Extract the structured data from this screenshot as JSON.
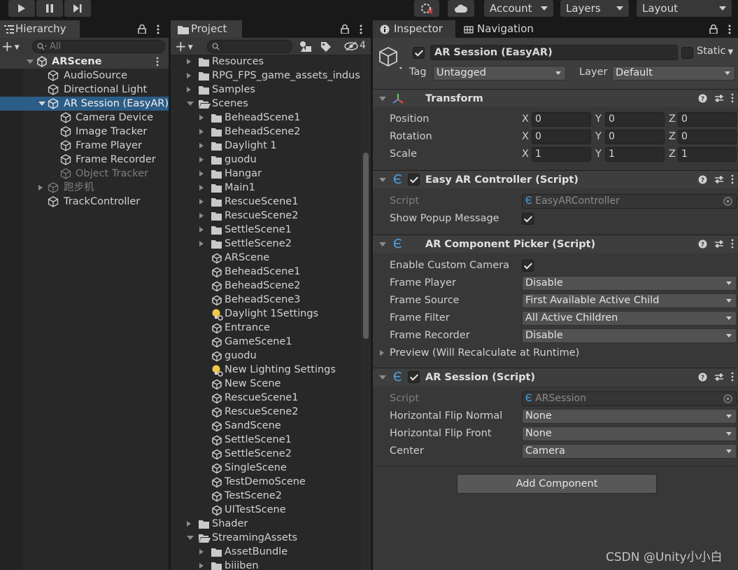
{
  "toolbar": {
    "account": "Account",
    "layers": "Layers",
    "layout": "Layout"
  },
  "hierarchy": {
    "tab": "Hierarchy",
    "search_placeholder": "All",
    "scene": "ARScene",
    "items": [
      {
        "label": "AudioSource"
      },
      {
        "label": "Directional Light"
      },
      {
        "label": "AR Session (EasyAR)"
      },
      {
        "label": "Camera Device"
      },
      {
        "label": "Image Tracker"
      },
      {
        "label": "Frame Player"
      },
      {
        "label": "Frame Recorder"
      },
      {
        "label": "Object Tracker"
      },
      {
        "label": "跑步机"
      },
      {
        "label": "TrackController"
      }
    ]
  },
  "project": {
    "tab": "Project",
    "hidden_count": "4",
    "items": [
      {
        "label": "Resources",
        "kind": "folder"
      },
      {
        "label": "RPG_FPS_game_assets_indus",
        "kind": "folder"
      },
      {
        "label": "Samples",
        "kind": "folder"
      },
      {
        "label": "Scenes",
        "kind": "folder-open"
      },
      {
        "label": "BeheadScene1",
        "kind": "folder"
      },
      {
        "label": "BeheadScene2",
        "kind": "folder"
      },
      {
        "label": "Daylight 1",
        "kind": "folder"
      },
      {
        "label": "guodu",
        "kind": "folder"
      },
      {
        "label": "Hangar",
        "kind": "folder"
      },
      {
        "label": "Main1",
        "kind": "folder"
      },
      {
        "label": "RescueScene1",
        "kind": "folder"
      },
      {
        "label": "RescueScene2",
        "kind": "folder"
      },
      {
        "label": "SettleScene1",
        "kind": "folder"
      },
      {
        "label": "SettleScene2",
        "kind": "folder"
      },
      {
        "label": "ARScene",
        "kind": "unity"
      },
      {
        "label": "BeheadScene1",
        "kind": "unity"
      },
      {
        "label": "BeheadScene2",
        "kind": "unity"
      },
      {
        "label": "BeheadScene3",
        "kind": "unity"
      },
      {
        "label": "Daylight 1Settings",
        "kind": "light"
      },
      {
        "label": "Entrance",
        "kind": "unity"
      },
      {
        "label": "GameScene1",
        "kind": "unity"
      },
      {
        "label": "guodu",
        "kind": "unity"
      },
      {
        "label": "New Lighting Settings",
        "kind": "light"
      },
      {
        "label": "New Scene",
        "kind": "unity"
      },
      {
        "label": "RescueScene1",
        "kind": "unity"
      },
      {
        "label": "RescueScene2",
        "kind": "unity"
      },
      {
        "label": "SandScene",
        "kind": "unity"
      },
      {
        "label": "SettleScene1",
        "kind": "unity"
      },
      {
        "label": "SettleScene2",
        "kind": "unity"
      },
      {
        "label": "SingleScene",
        "kind": "unity"
      },
      {
        "label": "TestDemoScene",
        "kind": "unity"
      },
      {
        "label": "TestScene2",
        "kind": "unity"
      },
      {
        "label": "UITestScene",
        "kind": "unity"
      },
      {
        "label": "Shader",
        "kind": "folder"
      },
      {
        "label": "StreamingAssets",
        "kind": "folder-open"
      },
      {
        "label": "AssetBundle",
        "kind": "folder"
      },
      {
        "label": "biiiben",
        "kind": "folder"
      }
    ]
  },
  "inspector": {
    "tab": "Inspector",
    "tab2": "Navigation",
    "object_name": "AR Session (EasyAR)",
    "static_label": "Static",
    "tag_label": "Tag",
    "tag_value": "Untagged",
    "layer_label": "Layer",
    "layer_value": "Default",
    "transform": {
      "title": "Transform",
      "position_label": "Position",
      "rotation_label": "Rotation",
      "scale_label": "Scale",
      "x": "X",
      "y": "Y",
      "z": "Z",
      "position": [
        "0",
        "0",
        "0"
      ],
      "rotation": [
        "0",
        "0",
        "0"
      ],
      "scale": [
        "1",
        "1",
        "1"
      ]
    },
    "easyar_controller": {
      "title": "Easy AR Controller (Script)",
      "script_label": "Script",
      "script_value": "EasyARController",
      "popup_label": "Show Popup Message"
    },
    "picker": {
      "title": "AR Component Picker (Script)",
      "custom_camera_label": "Enable Custom Camera",
      "frame_player_label": "Frame Player",
      "frame_player_value": "Disable",
      "frame_source_label": "Frame Source",
      "frame_source_value": "First Available Active Child",
      "frame_filter_label": "Frame Filter",
      "frame_filter_value": "All Active Children",
      "frame_recorder_label": "Frame Recorder",
      "frame_recorder_value": "Disable",
      "preview_label": "Preview (Will Recalculate at Runtime)"
    },
    "ar_session": {
      "title": "AR Session (Script)",
      "script_label": "Script",
      "script_value": "ARSession",
      "hflip_normal_label": "Horizontal Flip Normal",
      "hflip_normal_value": "None",
      "hflip_front_label": "Horizontal Flip Front",
      "hflip_front_value": "None",
      "center_label": "Center",
      "center_value": "Camera"
    },
    "add_component": "Add Component"
  },
  "watermark": "CSDN @Unity小小白",
  "colors": {
    "selection": "#2c5d87",
    "background": "#282828",
    "inspector_bg": "#383838",
    "script_icon": "#4aa3df"
  }
}
